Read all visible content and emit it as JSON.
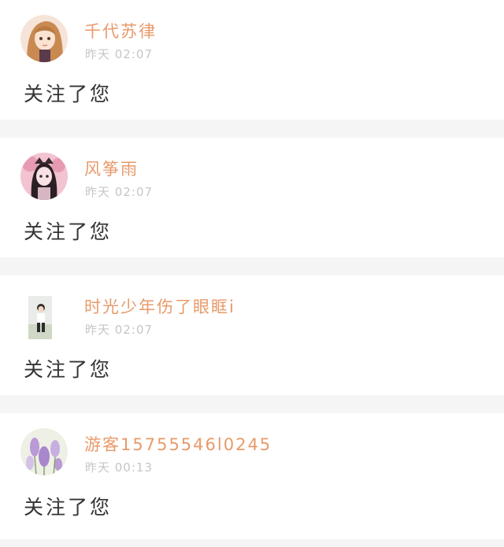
{
  "notifications": [
    {
      "username": "千代苏律",
      "time": "昨天 02:07",
      "message": "关注了您",
      "avatar": "avatar-anime-girl-orange-hair-icon"
    },
    {
      "username": "风筝雨",
      "time": "昨天 02:07",
      "message": "关注了您",
      "avatar": "avatar-doll-pink-icon"
    },
    {
      "username": "时光少年伤了眼眶i",
      "time": "昨天 02:07",
      "message": "关注了您",
      "avatar": "avatar-child-photo-icon"
    },
    {
      "username": "游客15755546l0245",
      "time": "昨天 00:13",
      "message": "关注了您",
      "avatar": "avatar-lavender-flowers-icon"
    }
  ]
}
